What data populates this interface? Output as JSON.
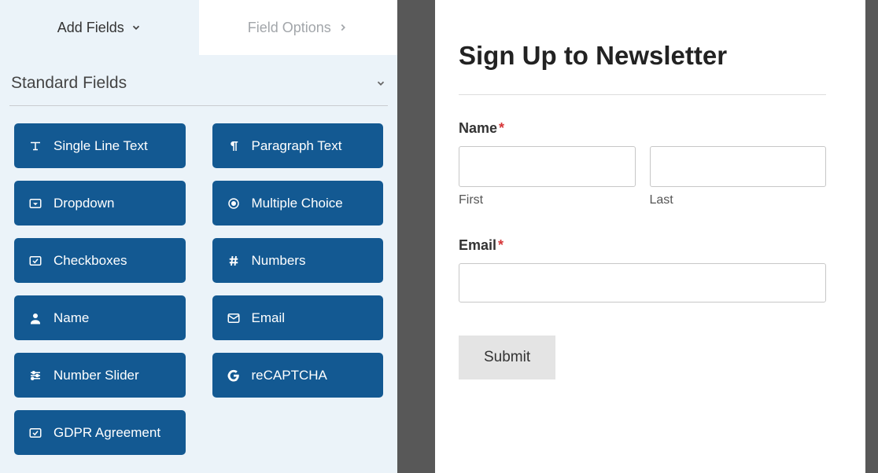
{
  "tabs": {
    "add": "Add Fields",
    "options": "Field Options"
  },
  "section": {
    "title": "Standard Fields"
  },
  "fields": {
    "single_line": "Single Line Text",
    "paragraph": "Paragraph Text",
    "dropdown": "Dropdown",
    "multiple_choice": "Multiple Choice",
    "checkboxes": "Checkboxes",
    "numbers": "Numbers",
    "name": "Name",
    "email": "Email",
    "number_slider": "Number Slider",
    "recaptcha": "reCAPTCHA",
    "gdpr": "GDPR Agreement"
  },
  "form": {
    "title": "Sign Up to Newsletter",
    "name_label": "Name",
    "first_label": "First",
    "last_label": "Last",
    "email_label": "Email",
    "submit": "Submit",
    "required": "*"
  }
}
